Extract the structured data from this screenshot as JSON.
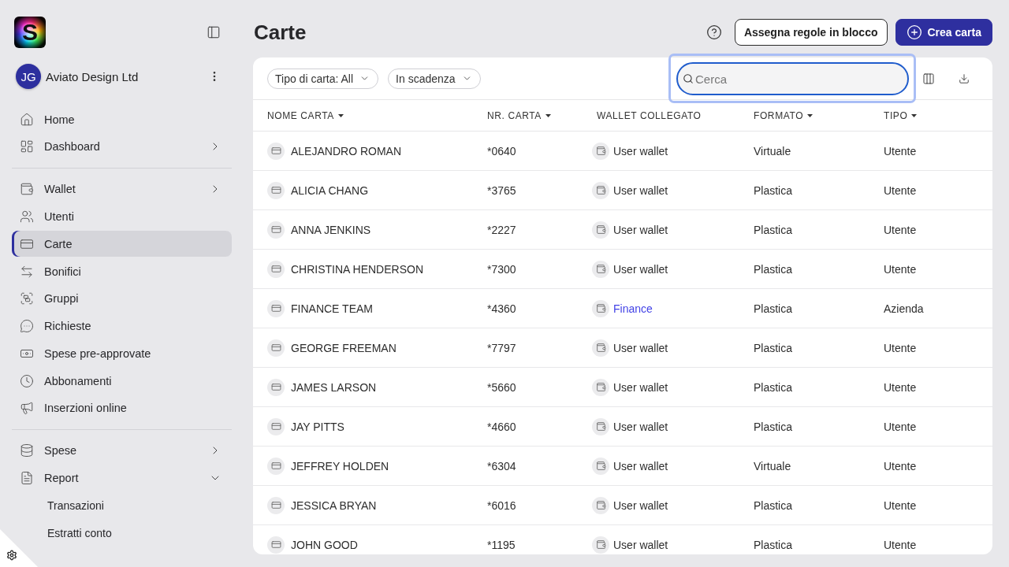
{
  "sidebar": {
    "logo": {
      "letter": "S"
    },
    "organization": {
      "initials": "JG",
      "name": "Aviato Design Ltd"
    },
    "sections": [
      {
        "items": [
          {
            "label": "Home",
            "selected": false
          },
          {
            "label": "Dashboard",
            "selected": false,
            "expanded": false
          }
        ]
      },
      {
        "items": [
          {
            "label": "Wallet",
            "selected": false,
            "expanded": false
          },
          {
            "label": "Utenti",
            "selected": false
          },
          {
            "label": "Carte",
            "selected": true
          },
          {
            "label": "Bonifici",
            "selected": false
          },
          {
            "label": "Gruppi",
            "selected": false
          },
          {
            "label": "Richieste",
            "selected": false
          },
          {
            "label": "Spese pre-approvate",
            "selected": false
          },
          {
            "label": "Abbonamenti",
            "selected": false
          },
          {
            "label": "Inserzioni online",
            "selected": false
          }
        ]
      },
      {
        "items": [
          {
            "label": "Spese",
            "selected": false,
            "expanded": false
          },
          {
            "label": "Report",
            "selected": false,
            "expanded": true,
            "children": [
              {
                "label": "Transazioni",
                "selected": false
              },
              {
                "label": "Estratti conto",
                "selected": false
              }
            ]
          }
        ]
      }
    ]
  },
  "page": {
    "title": "Carte",
    "buttons": [
      {
        "label": "Assegna regole in blocco",
        "kind": "secondary"
      },
      {
        "label": "Crea carta",
        "kind": "primary"
      }
    ]
  },
  "toolbar": {
    "filters": [
      "Tipo di carta: All",
      "In scadenza"
    ],
    "search": {
      "placeholder": "Cerca",
      "focused": true
    }
  },
  "table": {
    "columns": [
      {
        "label": "NOME CARTA",
        "sortable": true
      },
      {
        "label": "NR. CARTA",
        "sortable": true
      },
      {
        "label": "WALLET COLLEGATO",
        "sortable": false
      },
      {
        "label": "FORMATO",
        "sortable": true
      },
      {
        "label": "TIPO",
        "sortable": true
      }
    ],
    "rows": [
      {
        "name": "ALEJANDRO ROMAN",
        "number": "*0640",
        "wallet": {
          "label": "User wallet",
          "link": false
        },
        "format": "Virtuale",
        "type": "Utente"
      },
      {
        "name": "ALICIA CHANG",
        "number": "*3765",
        "wallet": {
          "label": "User wallet",
          "link": false
        },
        "format": "Plastica",
        "type": "Utente"
      },
      {
        "name": "ANNA JENKINS",
        "number": "*2227",
        "wallet": {
          "label": "User wallet",
          "link": false
        },
        "format": "Plastica",
        "type": "Utente"
      },
      {
        "name": "CHRISTINA HENDERSON",
        "number": "*7300",
        "wallet": {
          "label": "User wallet",
          "link": false
        },
        "format": "Plastica",
        "type": "Utente"
      },
      {
        "name": "FINANCE TEAM",
        "number": "*4360",
        "wallet": {
          "label": "Finance",
          "link": true
        },
        "format": "Plastica",
        "type": "Azienda"
      },
      {
        "name": "GEORGE FREEMAN",
        "number": "*7797",
        "wallet": {
          "label": "User wallet",
          "link": false
        },
        "format": "Plastica",
        "type": "Utente"
      },
      {
        "name": "JAMES LARSON",
        "number": "*5660",
        "wallet": {
          "label": "User wallet",
          "link": false
        },
        "format": "Plastica",
        "type": "Utente"
      },
      {
        "name": "JAY PITTS",
        "number": "*4660",
        "wallet": {
          "label": "User wallet",
          "link": false
        },
        "format": "Plastica",
        "type": "Utente"
      },
      {
        "name": "JEFFREY HOLDEN",
        "number": "*6304",
        "wallet": {
          "label": "User wallet",
          "link": false
        },
        "format": "Virtuale",
        "type": "Utente"
      },
      {
        "name": "JESSICA BRYAN",
        "number": "*6016",
        "wallet": {
          "label": "User wallet",
          "link": false
        },
        "format": "Plastica",
        "type": "Utente"
      },
      {
        "name": "JOHN GOOD",
        "number": "*1195",
        "wallet": {
          "label": "User wallet",
          "link": false
        },
        "format": "Plastica",
        "type": "Utente"
      }
    ]
  }
}
